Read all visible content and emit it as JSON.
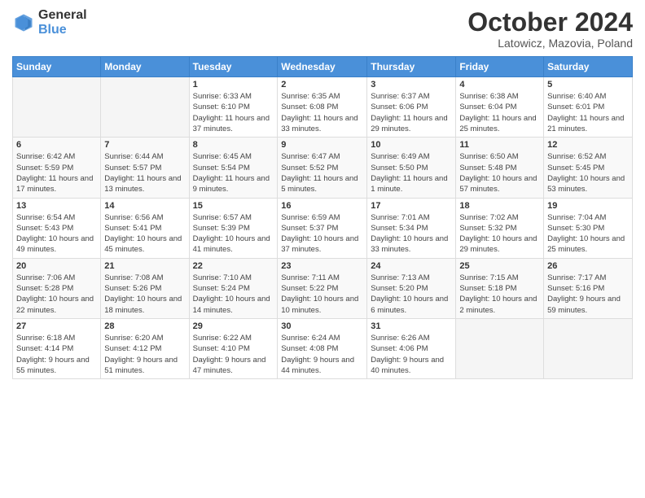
{
  "header": {
    "logo_general": "General",
    "logo_blue": "Blue",
    "title": "October 2024",
    "location": "Latowicz, Mazovia, Poland"
  },
  "weekdays": [
    "Sunday",
    "Monday",
    "Tuesday",
    "Wednesday",
    "Thursday",
    "Friday",
    "Saturday"
  ],
  "weeks": [
    [
      {
        "day": "",
        "info": ""
      },
      {
        "day": "",
        "info": ""
      },
      {
        "day": "1",
        "info": "Sunrise: 6:33 AM\nSunset: 6:10 PM\nDaylight: 11 hours and 37 minutes."
      },
      {
        "day": "2",
        "info": "Sunrise: 6:35 AM\nSunset: 6:08 PM\nDaylight: 11 hours and 33 minutes."
      },
      {
        "day": "3",
        "info": "Sunrise: 6:37 AM\nSunset: 6:06 PM\nDaylight: 11 hours and 29 minutes."
      },
      {
        "day": "4",
        "info": "Sunrise: 6:38 AM\nSunset: 6:04 PM\nDaylight: 11 hours and 25 minutes."
      },
      {
        "day": "5",
        "info": "Sunrise: 6:40 AM\nSunset: 6:01 PM\nDaylight: 11 hours and 21 minutes."
      }
    ],
    [
      {
        "day": "6",
        "info": "Sunrise: 6:42 AM\nSunset: 5:59 PM\nDaylight: 11 hours and 17 minutes."
      },
      {
        "day": "7",
        "info": "Sunrise: 6:44 AM\nSunset: 5:57 PM\nDaylight: 11 hours and 13 minutes."
      },
      {
        "day": "8",
        "info": "Sunrise: 6:45 AM\nSunset: 5:54 PM\nDaylight: 11 hours and 9 minutes."
      },
      {
        "day": "9",
        "info": "Sunrise: 6:47 AM\nSunset: 5:52 PM\nDaylight: 11 hours and 5 minutes."
      },
      {
        "day": "10",
        "info": "Sunrise: 6:49 AM\nSunset: 5:50 PM\nDaylight: 11 hours and 1 minute."
      },
      {
        "day": "11",
        "info": "Sunrise: 6:50 AM\nSunset: 5:48 PM\nDaylight: 10 hours and 57 minutes."
      },
      {
        "day": "12",
        "info": "Sunrise: 6:52 AM\nSunset: 5:45 PM\nDaylight: 10 hours and 53 minutes."
      }
    ],
    [
      {
        "day": "13",
        "info": "Sunrise: 6:54 AM\nSunset: 5:43 PM\nDaylight: 10 hours and 49 minutes."
      },
      {
        "day": "14",
        "info": "Sunrise: 6:56 AM\nSunset: 5:41 PM\nDaylight: 10 hours and 45 minutes."
      },
      {
        "day": "15",
        "info": "Sunrise: 6:57 AM\nSunset: 5:39 PM\nDaylight: 10 hours and 41 minutes."
      },
      {
        "day": "16",
        "info": "Sunrise: 6:59 AM\nSunset: 5:37 PM\nDaylight: 10 hours and 37 minutes."
      },
      {
        "day": "17",
        "info": "Sunrise: 7:01 AM\nSunset: 5:34 PM\nDaylight: 10 hours and 33 minutes."
      },
      {
        "day": "18",
        "info": "Sunrise: 7:02 AM\nSunset: 5:32 PM\nDaylight: 10 hours and 29 minutes."
      },
      {
        "day": "19",
        "info": "Sunrise: 7:04 AM\nSunset: 5:30 PM\nDaylight: 10 hours and 25 minutes."
      }
    ],
    [
      {
        "day": "20",
        "info": "Sunrise: 7:06 AM\nSunset: 5:28 PM\nDaylight: 10 hours and 22 minutes."
      },
      {
        "day": "21",
        "info": "Sunrise: 7:08 AM\nSunset: 5:26 PM\nDaylight: 10 hours and 18 minutes."
      },
      {
        "day": "22",
        "info": "Sunrise: 7:10 AM\nSunset: 5:24 PM\nDaylight: 10 hours and 14 minutes."
      },
      {
        "day": "23",
        "info": "Sunrise: 7:11 AM\nSunset: 5:22 PM\nDaylight: 10 hours and 10 minutes."
      },
      {
        "day": "24",
        "info": "Sunrise: 7:13 AM\nSunset: 5:20 PM\nDaylight: 10 hours and 6 minutes."
      },
      {
        "day": "25",
        "info": "Sunrise: 7:15 AM\nSunset: 5:18 PM\nDaylight: 10 hours and 2 minutes."
      },
      {
        "day": "26",
        "info": "Sunrise: 7:17 AM\nSunset: 5:16 PM\nDaylight: 9 hours and 59 minutes."
      }
    ],
    [
      {
        "day": "27",
        "info": "Sunrise: 6:18 AM\nSunset: 4:14 PM\nDaylight: 9 hours and 55 minutes."
      },
      {
        "day": "28",
        "info": "Sunrise: 6:20 AM\nSunset: 4:12 PM\nDaylight: 9 hours and 51 minutes."
      },
      {
        "day": "29",
        "info": "Sunrise: 6:22 AM\nSunset: 4:10 PM\nDaylight: 9 hours and 47 minutes."
      },
      {
        "day": "30",
        "info": "Sunrise: 6:24 AM\nSunset: 4:08 PM\nDaylight: 9 hours and 44 minutes."
      },
      {
        "day": "31",
        "info": "Sunrise: 6:26 AM\nSunset: 4:06 PM\nDaylight: 9 hours and 40 minutes."
      },
      {
        "day": "",
        "info": ""
      },
      {
        "day": "",
        "info": ""
      }
    ]
  ]
}
